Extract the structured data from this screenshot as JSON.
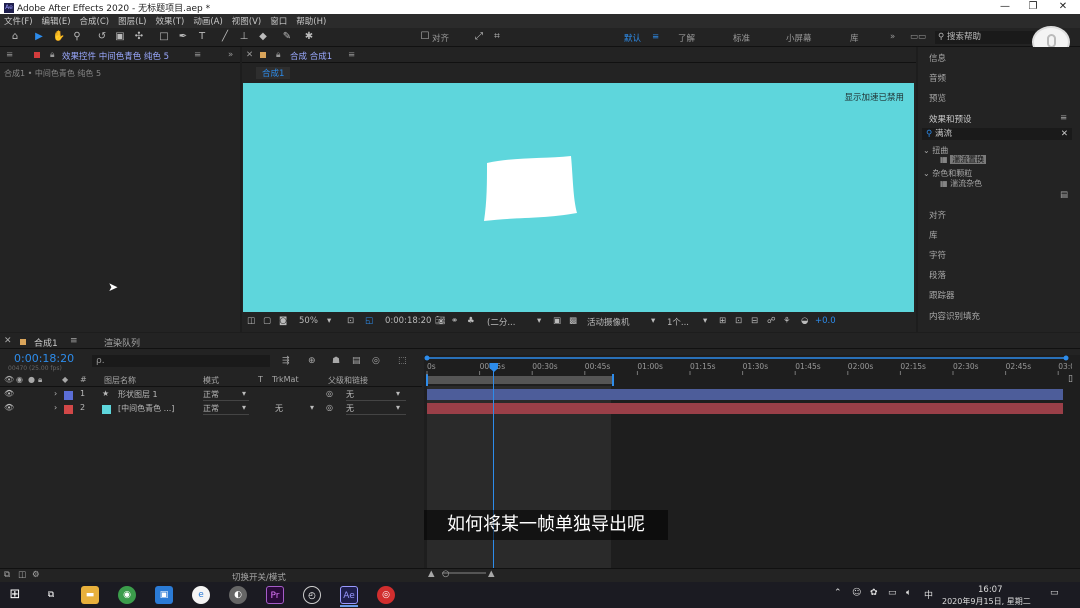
{
  "window": {
    "title": "Adobe After Effects 2020 - 无标题项目.aep *",
    "logo": "Ae"
  },
  "menu": [
    "文件(F)",
    "编辑(E)",
    "合成(C)",
    "图层(L)",
    "效果(T)",
    "动画(A)",
    "视图(V)",
    "窗口",
    "帮助(H)"
  ],
  "toolbar": {
    "align_label": "对齐",
    "workspaces": [
      "默认",
      "了解",
      "标准",
      "小屏幕",
      "库"
    ],
    "search_help": "搜索帮助"
  },
  "effects_panel": {
    "tab": "效果控件 中间色青色 纯色 5",
    "breadcrumb": "合成1 • 中间色青色 纯色 5"
  },
  "comp_panel": {
    "tab": "合成 合成1",
    "subtab": "合成1",
    "overlay": "显示加速已禁用"
  },
  "viewer_footer": {
    "zoom": "50%",
    "timecode": "0:00:18:20",
    "resolution": "(二分...",
    "camera": "活动摄像机",
    "views": "1个...",
    "exposure": "+0.0"
  },
  "right_panel": {
    "items_top": [
      "信息",
      "音频",
      "预览"
    ],
    "effects_title": "效果和预设",
    "search_value": "满流",
    "tree": [
      {
        "type": "group",
        "label": "扭曲"
      },
      {
        "type": "leaf",
        "label": "湍流置换"
      },
      {
        "type": "group",
        "label": "杂色和颗粒"
      },
      {
        "type": "leaf",
        "label": "湍流杂色"
      }
    ],
    "items_bottom": [
      "对齐",
      "库",
      "字符",
      "段落",
      "跟踪器",
      "内容识别填充"
    ]
  },
  "timeline": {
    "tab": "合成1",
    "render_tab": "渲染队列",
    "timecode": "0:00:18:20",
    "fps": "00470 (25.00 fps)",
    "search_placeholder": "ρ.",
    "col_number": "#",
    "col_name": "图层名称",
    "col_mode": "模式",
    "col_t": "T",
    "col_trkmat": "TrkMat",
    "col_parent": "父级和链接",
    "ruler": [
      "0s",
      "00:15s",
      "00:30s",
      "00:45s",
      "01:00s",
      "01:15s",
      "01:30s",
      "01:45s",
      "02:00s",
      "02:15s",
      "02:30s",
      "02:45s",
      "03:0"
    ],
    "layers": [
      {
        "num": "1",
        "name": "形状图层 1",
        "mode": "正常",
        "trkmat": "",
        "parent": "无",
        "color": "#5b6ed6",
        "bar": "#4d5d9a"
      },
      {
        "num": "2",
        "name": "[中间色青色 ...]",
        "mode": "正常",
        "trkmat": "无",
        "parent": "无",
        "color": "#d24848",
        "bar": "#9a3f48"
      }
    ],
    "toggle_label": "切换开关/模式",
    "playhead_fraction": 0.104
  },
  "subtitle": "如何将某一帧单独导出呢",
  "taskbar": {
    "time": "16:07",
    "date": "2020年9月15日, 星期二",
    "ime": "中"
  }
}
